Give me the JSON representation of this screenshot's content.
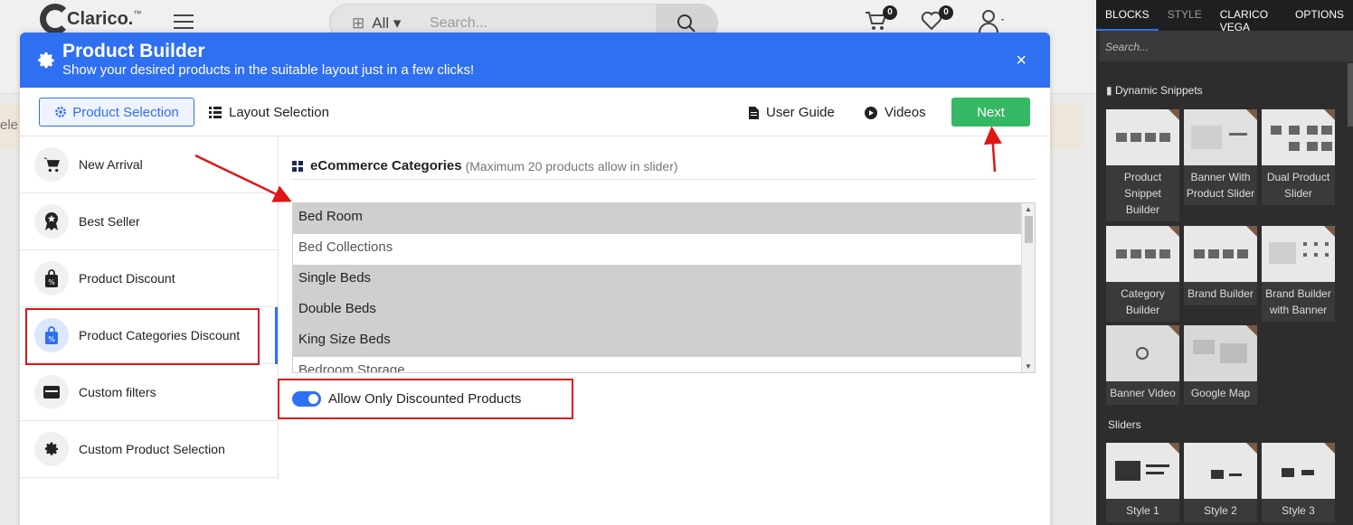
{
  "site": {
    "logo_text": "Clarico.",
    "logo_tm": "™",
    "search_category": "All",
    "search_placeholder": "Search...",
    "cart_count": "0",
    "wishlist_count": "0",
    "strip_text": "ele"
  },
  "modal": {
    "title": "Product Builder",
    "subtitle": "Show your desired products in the suitable layout just in a few clicks!",
    "close_label": "×",
    "tabs": {
      "product_selection": "Product Selection",
      "layout_selection": "Layout Selection"
    },
    "links": {
      "user_guide": "User Guide",
      "videos": "Videos"
    },
    "next_label": "Next",
    "sidebar_items": [
      {
        "label": "New Arrival",
        "icon": "cart-icon"
      },
      {
        "label": "Best Seller",
        "icon": "medal-icon"
      },
      {
        "label": "Product Discount",
        "icon": "discount-bag-icon"
      },
      {
        "label": "Product Categories Discount",
        "icon": "discount-bag-icon"
      },
      {
        "label": "Custom filters",
        "icon": "filter-card-icon"
      },
      {
        "label": "Custom Product Selection",
        "icon": "gear-icon"
      }
    ],
    "content": {
      "heading": "eCommerce Categories",
      "heading_note": "(Maximum 20 products allow in slider)",
      "categories": [
        {
          "label": "Bed Room",
          "selected": true
        },
        {
          "label": "Bed Collections",
          "selected": false
        },
        {
          "label": "Single Beds",
          "selected": true
        },
        {
          "label": "Double Beds",
          "selected": true
        },
        {
          "label": "King Size Beds",
          "selected": true
        },
        {
          "label": "Bedroom Storage",
          "selected": false
        }
      ],
      "toggle_label": "Allow Only Discounted Products",
      "toggle_on": true
    },
    "colors": {
      "header_blue": "#2f6ff2",
      "next_green": "#35b864",
      "annotation_red": "#e01515"
    }
  },
  "panel": {
    "tabs": [
      "BLOCKS",
      "STYLE",
      "CLARICO VEGA",
      "OPTIONS"
    ],
    "active_tab": "BLOCKS",
    "search_placeholder": "Search...",
    "dynamic_title": "Dynamic Snippets",
    "dynamic_snippets": [
      "Product Snippet Builder",
      "Banner With Product Slider",
      "Dual Product Slider",
      "Category Builder",
      "Brand Builder",
      "Brand Builder with Banner",
      "Banner Video",
      "Google Map"
    ],
    "sliders_title": "Sliders",
    "sliders": [
      "Style 1",
      "Style 2",
      "Style 3"
    ]
  }
}
